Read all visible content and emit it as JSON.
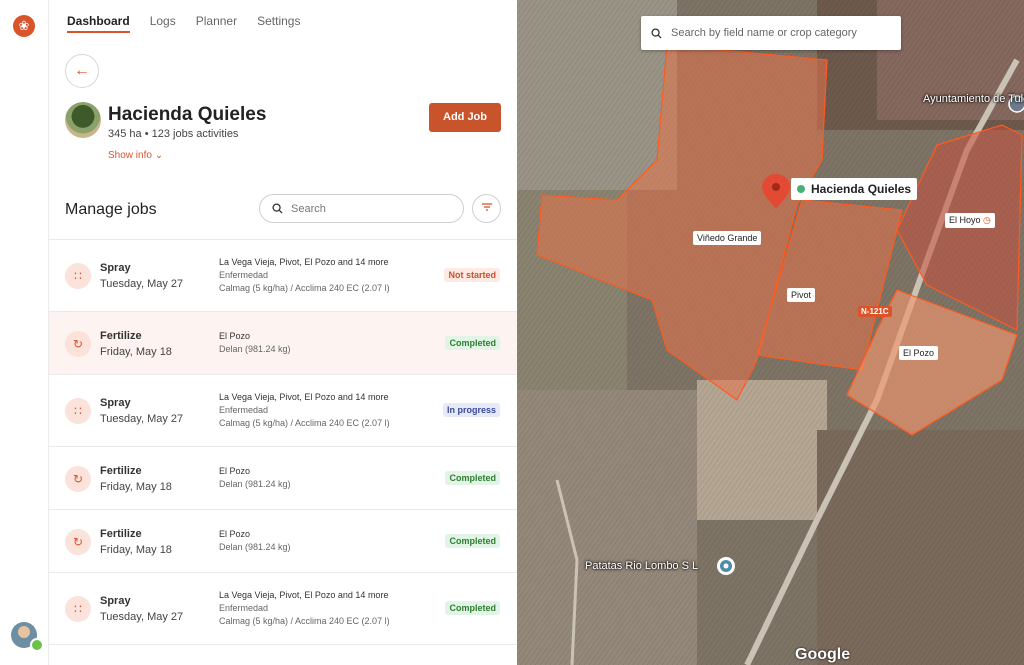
{
  "nav": {
    "tabs": [
      {
        "label": "Dashboard",
        "active": true
      },
      {
        "label": "Logs",
        "active": false
      },
      {
        "label": "Planner",
        "active": false
      },
      {
        "label": "Settings",
        "active": false
      }
    ]
  },
  "farm": {
    "name": "Hacienda Quieles",
    "summary": "345 ha • 123 jobs activities",
    "show_info": "Show info"
  },
  "actions": {
    "add_job": "Add Job",
    "back_icon": "arrow-left-icon",
    "filter_icon": "filter-icon"
  },
  "jobs_section": {
    "title": "Manage jobs",
    "search_placeholder": "Search"
  },
  "jobs": [
    {
      "type": "Spray",
      "date": "Tuesday, May 27",
      "fields": "La Vega Vieja, Pivot, El Pozo and 14 more",
      "line2": "Enfermedad",
      "line3": "Calmag (5 kg/ha) / Acclima 240 EC (2.07 l)",
      "status": "Not started",
      "status_key": "not-started",
      "icon": "spray-icon",
      "highlight": false
    },
    {
      "type": "Fertilize",
      "date": "Friday, May 18",
      "fields": "El Pozo",
      "line2": "Delan (981.24 kg)",
      "line3": "",
      "status": "Completed",
      "status_key": "completed",
      "icon": "fertilize-icon",
      "highlight": true
    },
    {
      "type": "Spray",
      "date": "Tuesday, May 27",
      "fields": "La Vega Vieja, Pivot, El Pozo and 14 more",
      "line2": "Enfermedad",
      "line3": "Calmag (5 kg/ha) / Acclima 240 EC (2.07 l)",
      "status": "In progress",
      "status_key": "in-progress",
      "icon": "spray-icon",
      "highlight": false
    },
    {
      "type": "Fertilize",
      "date": "Friday, May 18",
      "fields": "El Pozo",
      "line2": "Delan (981.24 kg)",
      "line3": "",
      "status": "Completed",
      "status_key": "completed",
      "icon": "fertilize-icon",
      "highlight": false
    },
    {
      "type": "Fertilize",
      "date": "Friday, May 18",
      "fields": "El Pozo",
      "line2": "Delan (981.24 kg)",
      "line3": "",
      "status": "Completed",
      "status_key": "completed",
      "icon": "fertilize-icon",
      "highlight": false
    },
    {
      "type": "Spray",
      "date": "Tuesday, May 27",
      "fields": "La Vega Vieja, Pivot, El Pozo and 14 more",
      "line2": "Enfermedad",
      "line3": "Calmag (5 kg/ha) / Acclima 240 EC (2.07 l)",
      "status": "Completed",
      "status_key": "completed",
      "icon": "spray-icon",
      "highlight": false
    }
  ],
  "map": {
    "search_placeholder": "Search by field name or crop category",
    "farm_marker": "Hacienda Quieles",
    "field_labels": [
      "Viñedo Grande",
      "Pivot",
      "El Hoyo",
      "El Pozo"
    ],
    "place_labels": [
      "Ayuntamiento de Tulebras",
      "Patatas Rio Lombo S L"
    ],
    "road": "N-121C",
    "attribution": "Google"
  },
  "colors": {
    "accent": "#d9542b",
    "field_fill": "#e8734a",
    "field_stroke": "#ff5a1f"
  }
}
